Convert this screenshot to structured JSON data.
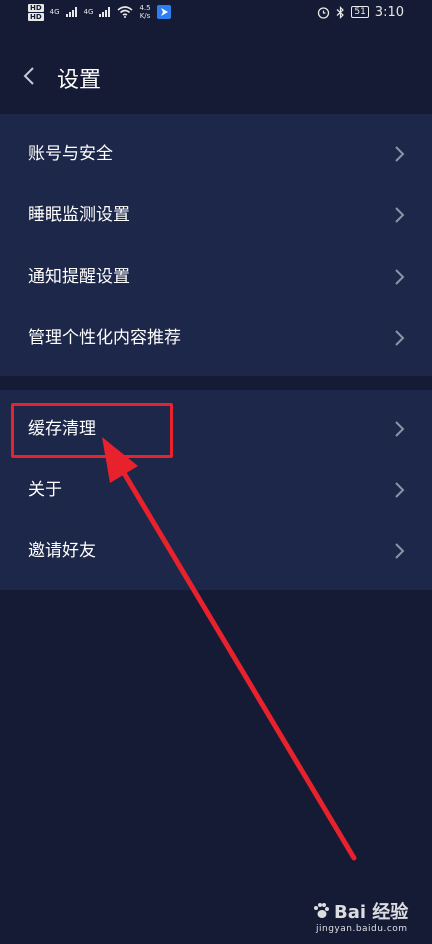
{
  "status_bar": {
    "hd1": "HD",
    "hd2": "HD",
    "net1": "4G",
    "net2": "4G",
    "speed": "4.5",
    "speed_unit": "K/s",
    "battery": "51",
    "time": "3:10"
  },
  "header": {
    "title": "设置"
  },
  "groups": [
    {
      "items": [
        {
          "label": "账号与安全"
        },
        {
          "label": "睡眠监测设置"
        },
        {
          "label": "通知提醒设置"
        },
        {
          "label": "管理个性化内容推荐"
        }
      ]
    },
    {
      "items": [
        {
          "label": "缓存清理"
        },
        {
          "label": "关于"
        },
        {
          "label": "邀请好友"
        }
      ]
    }
  ],
  "watermark": {
    "brand": "Bai 经验",
    "url": "jingyan.baidu.com"
  },
  "colors": {
    "background": "#151b35",
    "card": "#1d2749",
    "annotation": "#e8222c"
  }
}
